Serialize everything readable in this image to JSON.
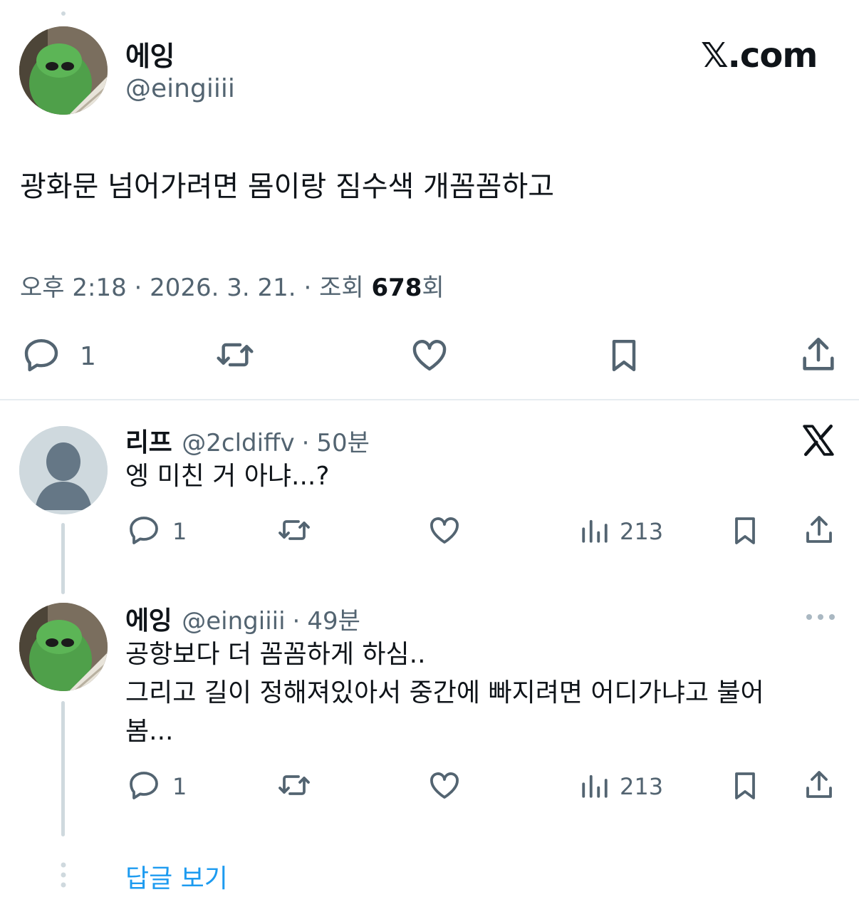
{
  "tweet": {
    "author_name": "에잉",
    "author_handle": "@eingiiii",
    "brand": "𝕏.com",
    "text": "광화문 넘어가려면 몸이랑 짐수색 개꼼꼼하고",
    "time": "오후 2:18",
    "date": "2026. 3. 21.",
    "views_label": "조회",
    "views_count": "678",
    "views_suffix": "회",
    "separator": "·",
    "reply_count": "1"
  },
  "replies": [
    {
      "name": "리프",
      "handle": "@2cldiffv",
      "age": "50분",
      "text": "엥 미친 거 아냐...?",
      "reply_count": "1",
      "view_count": "213"
    },
    {
      "name": "에잉",
      "handle": "@eingiiii",
      "age": "49분",
      "text_line1": "공항보다 더 꼼꼼하게 하심..",
      "text_line2": "그리고 길이 정해져있아서 중간에 빠지려면 어디가냐고 불어",
      "text_line3": "봄...",
      "reply_count": "1",
      "view_count": "213"
    }
  ],
  "show_replies_label": "답글 보기",
  "colors": {
    "accent": "#1d9bf0",
    "secondary_text": "#536471",
    "primary_text": "#0f1419"
  }
}
